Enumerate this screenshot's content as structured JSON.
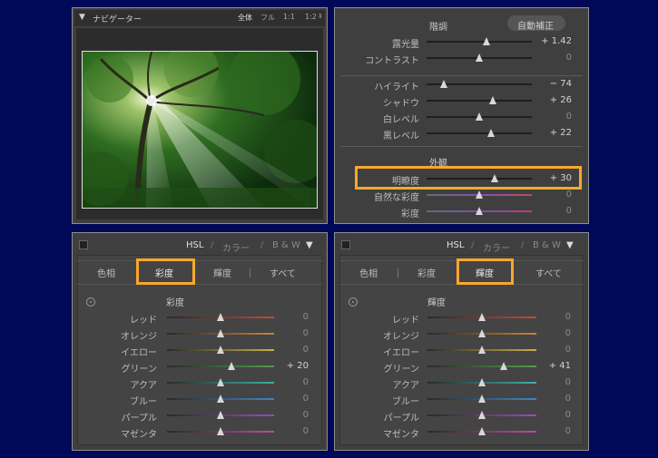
{
  "navigator": {
    "title": "ナビゲーター",
    "zoom_options": [
      "全体",
      "フル",
      "1:1",
      "1:2"
    ]
  },
  "basic": {
    "tone_header": "階調",
    "auto_button": "自動補正",
    "tone_rows": [
      {
        "label": "露光量",
        "value": "+ 1.42",
        "frac": 0.57
      },
      {
        "label": "コントラスト",
        "value": "0",
        "frac": 0.5
      }
    ],
    "light_rows": [
      {
        "label": "ハイライト",
        "value": "− 74",
        "frac": 0.16
      },
      {
        "label": "シャドウ",
        "value": "+ 26",
        "frac": 0.63
      },
      {
        "label": "白レベル",
        "value": "0",
        "frac": 0.5
      },
      {
        "label": "黒レベル",
        "value": "+ 22",
        "frac": 0.61
      }
    ],
    "presence_header": "外観",
    "presence_rows": [
      {
        "label": "明瞭度",
        "value": "+ 30",
        "frac": 0.65
      },
      {
        "label": "自然な彩度",
        "value": "0",
        "frac": 0.5
      },
      {
        "label": "彩度",
        "value": "0",
        "frac": 0.5
      }
    ]
  },
  "hsl_left": {
    "header": {
      "hsl": "HSL",
      "sep": "/",
      "color": "カラー",
      "bw": "B & W"
    },
    "tabs": [
      "色相",
      "彩度",
      "輝度",
      "すべて"
    ],
    "selected_tab": 1,
    "section_title": "彩度",
    "rows": [
      {
        "label": "レッド",
        "value": "0",
        "frac": 0.5
      },
      {
        "label": "オレンジ",
        "value": "0",
        "frac": 0.5
      },
      {
        "label": "イエロー",
        "value": "0",
        "frac": 0.5
      },
      {
        "label": "グリーン",
        "value": "+ 20",
        "frac": 0.6
      },
      {
        "label": "アクア",
        "value": "0",
        "frac": 0.5
      },
      {
        "label": "ブルー",
        "value": "0",
        "frac": 0.5
      },
      {
        "label": "パープル",
        "value": "0",
        "frac": 0.5
      },
      {
        "label": "マゼンタ",
        "value": "0",
        "frac": 0.5
      }
    ]
  },
  "hsl_right": {
    "header": {
      "hsl": "HSL",
      "sep": "/",
      "color": "カラー",
      "bw": "B & W"
    },
    "tabs": [
      "色相",
      "彩度",
      "輝度",
      "すべて"
    ],
    "selected_tab": 2,
    "section_title": "輝度",
    "rows": [
      {
        "label": "レッド",
        "value": "0",
        "frac": 0.5
      },
      {
        "label": "オレンジ",
        "value": "0",
        "frac": 0.5
      },
      {
        "label": "イエロー",
        "value": "0",
        "frac": 0.5
      },
      {
        "label": "グリーン",
        "value": "+ 41",
        "frac": 0.7
      },
      {
        "label": "アクア",
        "value": "0",
        "frac": 0.5
      },
      {
        "label": "ブルー",
        "value": "0",
        "frac": 0.5
      },
      {
        "label": "パープル",
        "value": "0",
        "frac": 0.5
      },
      {
        "label": "マゼンタ",
        "value": "0",
        "frac": 0.5
      }
    ]
  },
  "colors": {
    "highlight": "#f7a82c",
    "background": "#000957",
    "track_red": "#c24a3a",
    "track_orange": "#c8843a",
    "track_yellow": "#c8b04a",
    "track_green": "#4ea04a",
    "track_aqua": "#3ab0a8",
    "track_blue": "#3a86c8",
    "track_purple": "#9a4ac0",
    "track_magenta": "#c04aa0"
  }
}
